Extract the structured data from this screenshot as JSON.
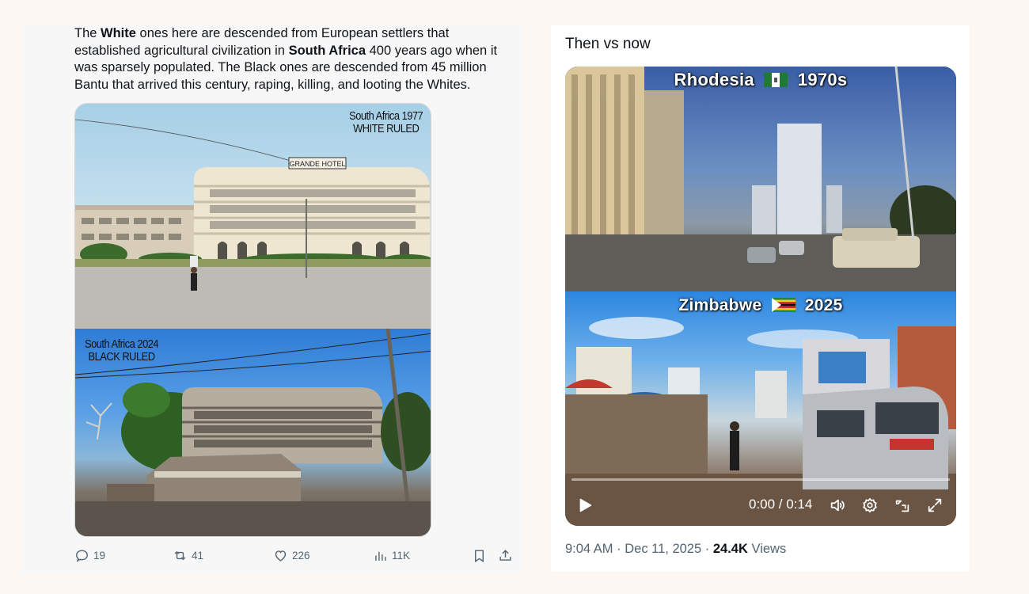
{
  "left_tweet": {
    "text": {
      "p1": "The ",
      "b1": "White",
      "p2": " ones here are descended from European settlers that established agricultural civilization in ",
      "b2": "South Africa",
      "p3": " 400 years ago when it was sparsely populated. The Black ones are descended from 45 million Bantu that arrived this century, raping, killing, and looting the Whites."
    },
    "photo_top": {
      "label_line1": "South Africa 1977",
      "label_line2": "WHITE RULED",
      "sign": "GRANDE HOTEL"
    },
    "photo_bottom": {
      "label_line1": "South Africa 2024",
      "label_line2": "BLACK RULED"
    },
    "actions": {
      "replies": "19",
      "reposts": "41",
      "likes": "226",
      "views": "11K"
    }
  },
  "right_tweet": {
    "text": "Then vs now",
    "video": {
      "top_caption_left": "Rhodesia",
      "top_caption_right": "1970s",
      "bottom_caption_left": "Zimbabwe",
      "bottom_caption_right": "2025",
      "timecode": "0:00 / 0:14",
      "progress_fraction": 0.0
    },
    "meta": {
      "time": "9:04 AM",
      "date": "Dec 11, 2025",
      "views_count": "24.4K",
      "views_label": "Views"
    }
  },
  "colors": {
    "page_bg": "#fdf7f3",
    "left_card_bg": "#f7f7f7",
    "right_card_bg": "#ffffff",
    "muted_text": "#536471"
  },
  "icons": [
    "reply-icon",
    "repost-icon",
    "like-icon",
    "views-icon",
    "bookmark-icon",
    "share-icon",
    "play-icon",
    "volume-icon",
    "settings-icon",
    "pip-icon",
    "fullscreen-icon"
  ]
}
